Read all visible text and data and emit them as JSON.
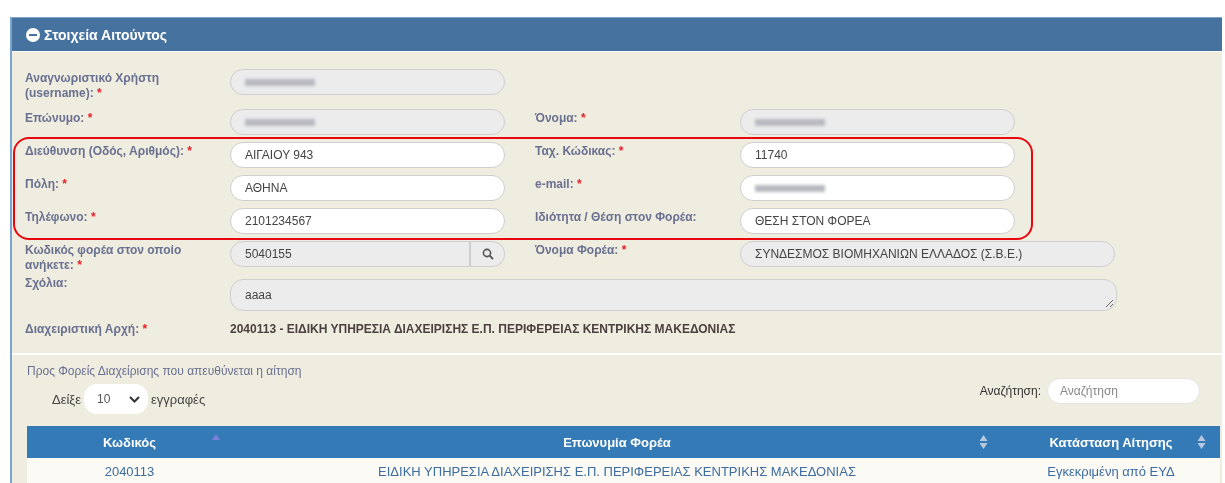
{
  "panel": {
    "title": "Στοιχεία Αιτούντος",
    "expanded": true
  },
  "rows": [
    {
      "fields": [
        {
          "label": "Αναγνωριστικό Χρήστη (username):",
          "mark": "*",
          "kind": "text",
          "editable": false,
          "redacted": true
        }
      ]
    },
    {
      "fields": [
        {
          "label": "Επώνυμο:",
          "mark": "*",
          "kind": "text",
          "editable": false,
          "redacted": true
        },
        {
          "label": "Όνομα:",
          "mark": "*",
          "kind": "text",
          "editable": false,
          "redacted": true
        }
      ]
    },
    {
      "fields": [
        {
          "label": "Διεύθυνση (Οδός, Αριθμός):",
          "mark": "*",
          "kind": "text",
          "editable": true,
          "redacted": false,
          "value": "ΑΙΓΑΙΟΥ 943"
        },
        {
          "label": "Ταχ. Κώδικας:",
          "mark": "*",
          "kind": "text",
          "editable": true,
          "redacted": false,
          "value": "11740"
        }
      ]
    },
    {
      "fields": [
        {
          "label": "Πόλη:",
          "mark": "*",
          "kind": "text",
          "editable": true,
          "redacted": false,
          "value": "ΑΘΗΝΑ"
        },
        {
          "label": "e-mail:",
          "mark": "*",
          "kind": "text",
          "editable": true,
          "redacted": true
        }
      ]
    },
    {
      "fields": [
        {
          "label": "Τηλέφωνο:",
          "mark": "*",
          "kind": "text",
          "editable": true,
          "redacted": false,
          "value": "2101234567"
        },
        {
          "label": "Ιδιότητα / Θέση στον Φορέα:",
          "kind": "text",
          "editable": true,
          "redacted": false,
          "value": "ΘΕΣΗ ΣΤΟΝ ΦΟΡΕΑ"
        }
      ]
    },
    {
      "fields": [
        {
          "label": "Κωδικός φορέα στον οποίο ανήκετε:",
          "mark": "*",
          "kind": "lookup",
          "editable": false,
          "redacted": false,
          "value": "5040155"
        },
        {
          "label": "Όνομα Φορέα:",
          "mark": "*",
          "kind": "text",
          "editable": false,
          "redacted": false,
          "value": "ΣΥΝΔΕΣΜΟΣ ΒΙΟΜΗΧΑΝΙΩΝ ΕΛΛΑΔΟΣ (Σ.Β.Ε.)"
        }
      ]
    },
    {
      "fields": [
        {
          "label": "Σχόλια:",
          "kind": "textarea",
          "editable": false,
          "redacted": false,
          "value": "aaaa"
        }
      ]
    },
    {
      "fields": [
        {
          "label": "Διαχειριστική Αρχή:",
          "mark": "*",
          "kind": "static",
          "value": "2040113 - ΕΙΔΙΚΗ ΥΠΗΡΕΣΙΑ ΔΙΑΧΕΙΡΙΣΗΣ Ε.Π. ΠΕΡΙΦΕΡΕΙΑΣ ΚΕΝΤΡΙΚΗΣ ΜΑΚΕΔΟΝΙΑΣ"
        }
      ]
    }
  ],
  "recipients": {
    "title": "Προς Φορείς Διαχείρισης που απευθύνεται η αίτηση",
    "show_label": "Δείξε",
    "page_length": "10",
    "entries_label": "εγγραφές",
    "search_label": "Αναζήτηση:",
    "search": {
      "placeholder": "Αναζήτηση"
    },
    "table": {
      "columns": [
        {
          "label": "Κωδικός",
          "sorted": true
        },
        {
          "label": "Επωνυμία Φορέα",
          "sorted": false
        },
        {
          "label": "Κατάσταση Αίτησης",
          "sorted": false
        }
      ],
      "rows": [
        [
          "2040113",
          "ΕΙΔΙΚΗ ΥΠΗΡΕΣΙΑ ΔΙΑΧΕΙΡΙΣΗΣ Ε.Π. ΠΕΡΙΦΕΡΕΙΑΣ ΚΕΝΤΡΙΚΗΣ ΜΑΚΕΔΟΝΙΑΣ",
          "Εγκεκριμένη από ΕΥΔ"
        ]
      ]
    }
  }
}
